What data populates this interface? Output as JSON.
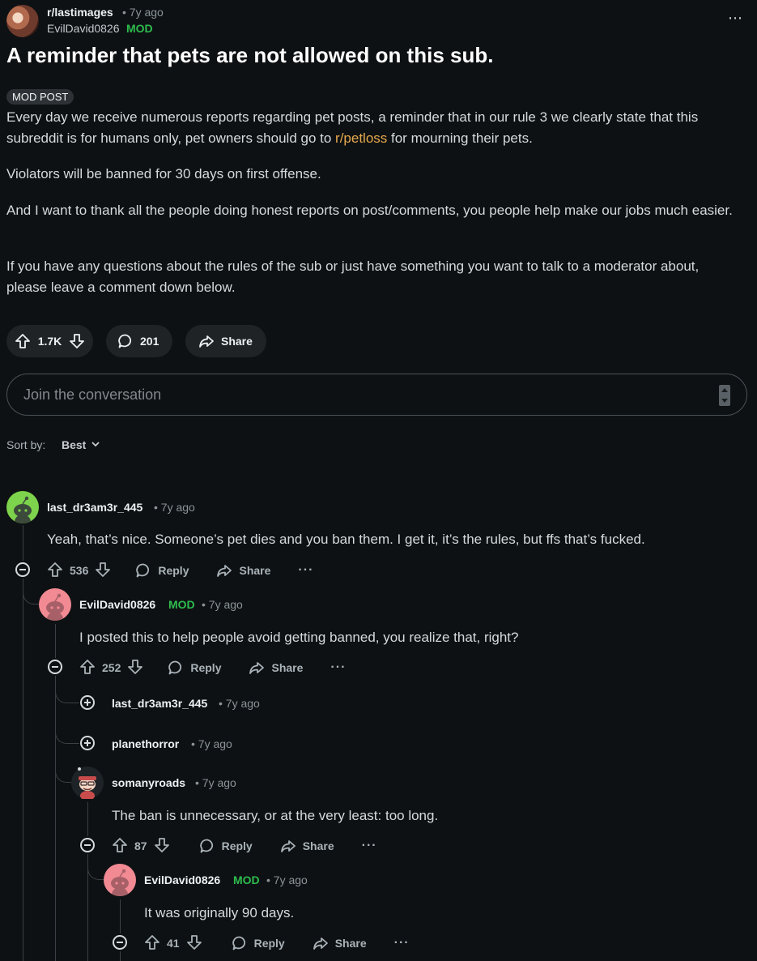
{
  "post": {
    "subreddit": "r/lastimages",
    "time": "• 7y ago",
    "author": "EvilDavid0826",
    "author_badge": "MOD",
    "title": "A reminder that pets are not allowed on this sub.",
    "flair": "MOD POST",
    "body": {
      "p1_before": "Every day we receive numerous reports regarding pet posts, a reminder that in our rule 3 we clearly state that this subreddit is for humans only, pet owners should go to ",
      "p1_link": "r/petloss",
      "p1_after": " for mourning their pets.",
      "p2": "Violators will be banned for 30 days on first offense.",
      "p3": "And I want to thank all the people doing honest reports on post/comments, you people help make our jobs much easier.",
      "p4": "If you have any questions about the rules of the sub or just have something you want to talk to a moderator about, please leave a comment down below."
    },
    "score": "1.7K",
    "comments": "201",
    "share_label": "Share"
  },
  "composer": {
    "placeholder": "Join the conversation"
  },
  "sort": {
    "label": "Sort by:",
    "value": "Best"
  },
  "colors": {
    "background": "#0e1113",
    "mod_green": "#2dbd4e",
    "link": "#e6a94e"
  },
  "comments": [
    {
      "author": "last_dr3am3r_445",
      "time": "• 7y ago",
      "text": "Yeah, that’s nice. Someone’s pet dies and you ban them. I get it, it’s the rules, but ffs that’s fucked.",
      "score": "536",
      "reply": "Reply",
      "share": "Share",
      "more": "···",
      "avatar": "green-snoo"
    },
    {
      "author": "EvilDavid0826",
      "badge": "MOD",
      "time": "• 7y ago",
      "text": "I posted this to help people avoid getting banned, you realize that, right?",
      "score": "252",
      "reply": "Reply",
      "share": "Share",
      "more": "···",
      "avatar": "pink-snoo"
    },
    {
      "author": "last_dr3am3r_445",
      "time": "• 7y ago",
      "collapsed": true
    },
    {
      "author": "planethorror",
      "time": "• 7y ago",
      "collapsed": true
    },
    {
      "author": "somanyroads",
      "time": "• 7y ago",
      "text": "The ban is unnecessary, or at the very least: too long.",
      "score": "87",
      "reply": "Reply",
      "share": "Share",
      "more": "···",
      "avatar": "custom-snoo"
    },
    {
      "author": "EvilDavid0826",
      "badge": "MOD",
      "time": "• 7y ago",
      "text": "It was originally 90 days.",
      "score": "41",
      "reply": "Reply",
      "share": "Share",
      "more": "···",
      "avatar": "pink-snoo"
    }
  ]
}
